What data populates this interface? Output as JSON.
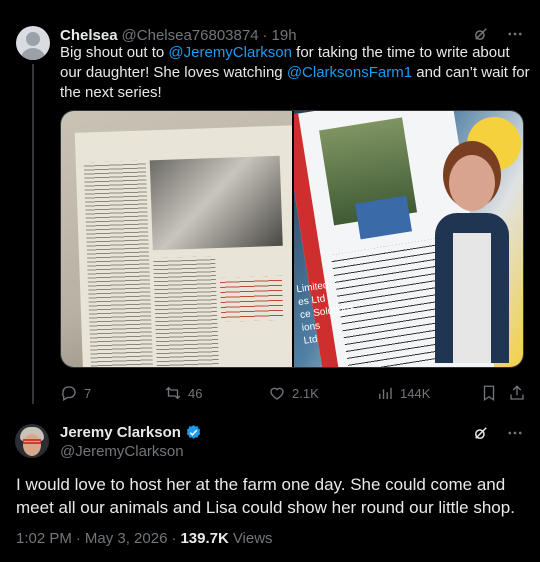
{
  "reply_tweet": {
    "display_name": "Chelsea",
    "handle": "@Chelsea76803874",
    "time": "19h",
    "text_parts": [
      "Big shout out to ",
      "@JeremyClarkson",
      " for taking the time to write about our daughter! She loves watching ",
      "@ClarksonsFarm1",
      " and can’t wait for the next series!"
    ],
    "media_side_text": "Limited\nes Ltd\nce Solutions\nions\nLtd",
    "actions": {
      "replies": "7",
      "reposts": "46",
      "likes": "2.1K",
      "views": "144K"
    }
  },
  "main_tweet": {
    "display_name": "Jeremy Clarkson",
    "handle": "@JeremyClarkson",
    "text": "I would love to host her at the farm one day. She could come and meet all our animals and Lisa could show her round our little shop.",
    "time": "1:02 PM",
    "date": "May 3, 2026",
    "views_count": "139.7K",
    "views_label": "Views"
  },
  "colors": {
    "background": "#000000",
    "text": "#e7e9ea",
    "muted": "#71767b",
    "link": "#1d9bf0",
    "verified": "#1d9bf0"
  },
  "icons": [
    "grok-icon",
    "more-icon",
    "reply-icon",
    "repost-icon",
    "like-icon",
    "views-icon",
    "bookmark-icon",
    "share-icon",
    "verified-badge-icon"
  ]
}
